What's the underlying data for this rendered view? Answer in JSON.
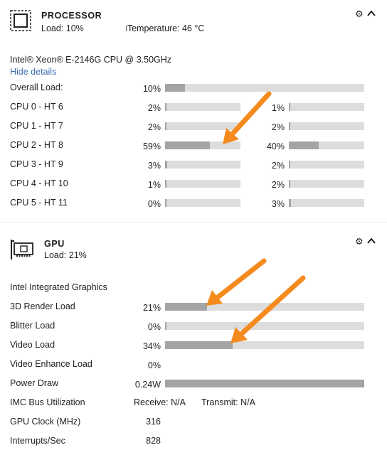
{
  "processor": {
    "title": "PROCESSOR",
    "load_text": "Load: 10%",
    "temperature_text": "Temperature: 46 °C",
    "model": "Intel® Xeon® E-2146G CPU @ 3.50GHz",
    "hide_details": "Hide details",
    "overall": {
      "label": "Overall Load:",
      "value_text": "10%",
      "value": 10
    },
    "cpus": [
      {
        "label": "CPU 0 - HT 6",
        "a_text": "2%",
        "a": 2,
        "b_text": "1%",
        "b": 1
      },
      {
        "label": "CPU 1 - HT 7",
        "a_text": "2%",
        "a": 2,
        "b_text": "2%",
        "b": 2
      },
      {
        "label": "CPU 2 - HT 8",
        "a_text": "59%",
        "a": 59,
        "b_text": "40%",
        "b": 40
      },
      {
        "label": "CPU 3 - HT 9",
        "a_text": "3%",
        "a": 3,
        "b_text": "2%",
        "b": 2
      },
      {
        "label": "CPU 4 - HT 10",
        "a_text": "1%",
        "a": 1,
        "b_text": "2%",
        "b": 2
      },
      {
        "label": "CPU 5 - HT 11",
        "a_text": "0%",
        "a": 0,
        "b_text": "3%",
        "b": 3
      }
    ]
  },
  "gpu": {
    "title": "GPU",
    "load_text": "Load: 21%",
    "name": "Intel Integrated Graphics",
    "render": {
      "label": "3D Render Load",
      "value_text": "21%",
      "value": 21
    },
    "blitter": {
      "label": "Blitter Load",
      "value_text": "0%",
      "value": 0
    },
    "video": {
      "label": "Video Load",
      "value_text": "34%",
      "value": 34
    },
    "video_enhance": {
      "label": "Video Enhance Load",
      "value_text": "0%"
    },
    "power": {
      "label": "Power Draw",
      "value_text": "0.24W",
      "value": 100
    },
    "imc": {
      "label": "IMC Bus Utilization",
      "receive": "Receive: N/A",
      "transmit": "Transmit: N/A"
    },
    "clock": {
      "label": "GPU Clock (MHz)",
      "value_text": "316"
    },
    "interrupts": {
      "label": "Interrupts/Sec",
      "value_text": "828"
    }
  },
  "icons": {
    "settings": "⚙",
    "collapse": "^",
    "thermometer": "🌡"
  },
  "colors": {
    "bar_track": "#dddddd",
    "bar_fill": "#a4a4a4",
    "arrow": "#f58a1f",
    "link": "#3a6fb0"
  }
}
